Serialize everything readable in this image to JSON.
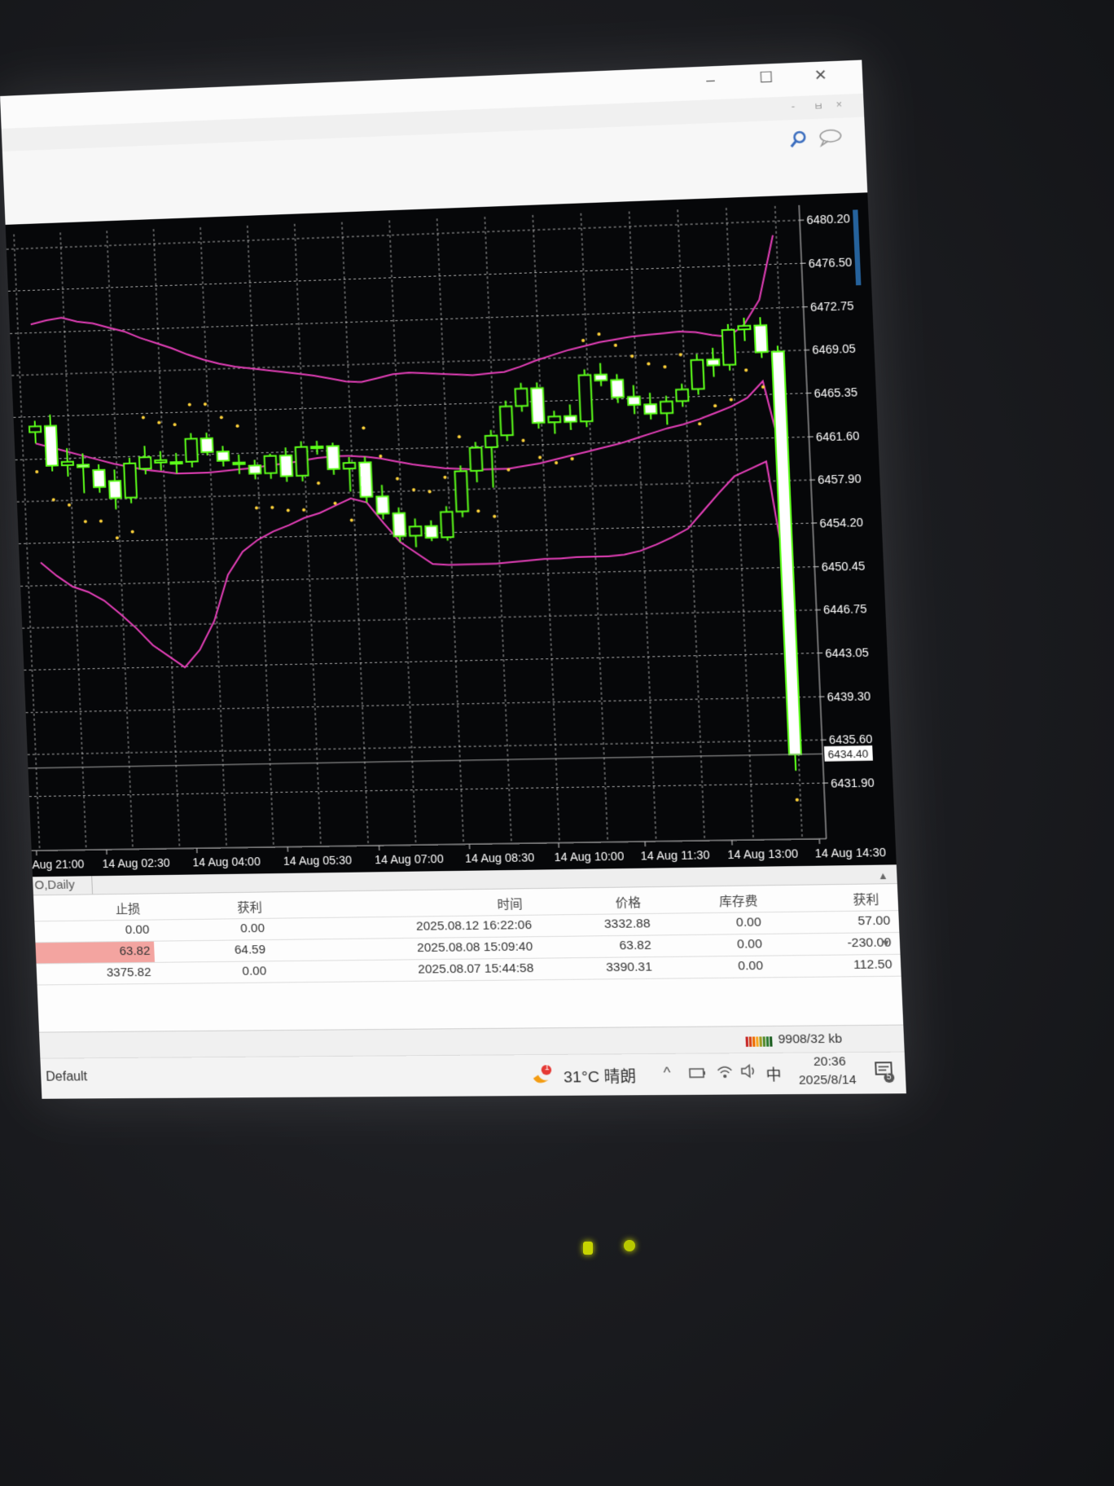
{
  "window": {
    "minimize": "–",
    "maximize": "☐",
    "close": "✕"
  },
  "mdi": {
    "minimize": "-",
    "restore": "ㅂ",
    "close": "×"
  },
  "toolbar_icons": [
    "search-icon",
    "chat-icon"
  ],
  "price_axis": [
    "6480.20",
    "6476.50",
    "6472.75",
    "6469.05",
    "6465.35",
    "6461.60",
    "6457.90",
    "6454.20",
    "6450.45",
    "6446.75",
    "6443.05",
    "6439.30",
    "6435.60",
    "6431.90"
  ],
  "current_price": "6434.40",
  "time_axis": [
    "Aug 21:00",
    "14 Aug 02:30",
    "14 Aug 04:00",
    "14 Aug 05:30",
    "14 Aug 07:00",
    "14 Aug 08:30",
    "14 Aug 10:00",
    "14 Aug 11:30",
    "14 Aug 13:00",
    "14 Aug 14:30"
  ],
  "chart_data": {
    "type": "candlestick",
    "ylim": [
      6430.0,
      6481.5
    ],
    "y_ticks": [
      6480.2,
      6476.5,
      6472.75,
      6469.05,
      6465.35,
      6461.6,
      6457.9,
      6454.2,
      6450.45,
      6446.75,
      6443.05,
      6439.3,
      6435.6,
      6431.9
    ],
    "x_ticks": [
      "Aug 21:00",
      "14 Aug 02:30",
      "14 Aug 04:00",
      "14 Aug 05:30",
      "14 Aug 07:00",
      "14 Aug 08:30",
      "14 Aug 10:00",
      "14 Aug 11:30",
      "14 Aug 13:00",
      "14 Aug 14:30"
    ],
    "candles": [
      [
        6464.0,
        6465.0,
        6463.0,
        6464.5
      ],
      [
        6464.5,
        6465.5,
        6460.5,
        6461.0
      ],
      [
        6461.0,
        6462.5,
        6460.0,
        6461.3
      ],
      [
        6461.0,
        6462.0,
        6458.5,
        6460.8
      ],
      [
        6460.5,
        6461.0,
        6458.5,
        6459.0
      ],
      [
        6459.5,
        6460.5,
        6457.0,
        6458.0
      ],
      [
        6458.0,
        6461.5,
        6457.5,
        6461.0
      ],
      [
        6460.5,
        6462.5,
        6460.0,
        6461.5
      ],
      [
        6461.0,
        6462.0,
        6460.3,
        6461.2
      ],
      [
        6461.0,
        6461.8,
        6460.0,
        6461.0
      ],
      [
        6461.0,
        6463.5,
        6460.5,
        6463.0
      ],
      [
        6463.0,
        6463.5,
        6461.5,
        6461.8
      ],
      [
        6461.8,
        6462.3,
        6460.5,
        6461.0
      ],
      [
        6460.8,
        6461.5,
        6459.8,
        6460.8
      ],
      [
        6460.5,
        6461.0,
        6459.3,
        6459.8
      ],
      [
        6459.8,
        6461.5,
        6459.3,
        6461.3
      ],
      [
        6461.3,
        6462.0,
        6459.0,
        6459.5
      ],
      [
        6459.5,
        6462.5,
        6459.0,
        6462.0
      ],
      [
        6462.0,
        6462.5,
        6461.3,
        6462.0
      ],
      [
        6462.0,
        6462.3,
        6459.5,
        6460.0
      ],
      [
        6460.0,
        6461.0,
        6458.0,
        6460.5
      ],
      [
        6460.5,
        6461.0,
        6457.0,
        6457.5
      ],
      [
        6457.5,
        6458.5,
        6455.5,
        6456.0
      ],
      [
        6456.0,
        6456.5,
        6453.5,
        6454.0
      ],
      [
        6454.0,
        6455.5,
        6453.0,
        6454.8
      ],
      [
        6454.8,
        6455.3,
        6453.5,
        6453.8
      ],
      [
        6453.8,
        6456.5,
        6453.5,
        6456.0
      ],
      [
        6456.0,
        6460.0,
        6455.5,
        6459.5
      ],
      [
        6459.5,
        6462.0,
        6458.5,
        6461.5
      ],
      [
        6461.5,
        6463.0,
        6458.0,
        6462.5
      ],
      [
        6462.5,
        6465.5,
        6462.0,
        6465.0
      ],
      [
        6465.0,
        6467.0,
        6464.5,
        6466.5
      ],
      [
        6466.5,
        6467.0,
        6463.0,
        6463.5
      ],
      [
        6463.5,
        6464.5,
        6462.5,
        6464.0
      ],
      [
        6464.0,
        6465.0,
        6462.8,
        6463.5
      ],
      [
        6463.5,
        6468.0,
        6463.0,
        6467.5
      ],
      [
        6467.5,
        6468.5,
        6466.5,
        6467.0
      ],
      [
        6467.0,
        6467.5,
        6465.0,
        6465.5
      ],
      [
        6465.5,
        6466.5,
        6464.0,
        6464.8
      ],
      [
        6464.8,
        6465.8,
        6463.5,
        6464.0
      ],
      [
        6464.0,
        6465.5,
        6463.0,
        6465.0
      ],
      [
        6465.0,
        6466.5,
        6464.5,
        6466.0
      ],
      [
        6466.0,
        6469.0,
        6465.5,
        6468.5
      ],
      [
        6468.5,
        6469.5,
        6467.0,
        6468.0
      ],
      [
        6468.0,
        6471.5,
        6467.5,
        6471.0
      ],
      [
        6471.0,
        6472.0,
        6470.0,
        6471.3
      ],
      [
        6471.3,
        6472.0,
        6468.5,
        6469.0
      ],
      [
        6469.0,
        6469.5,
        6433.0,
        6434.4
      ]
    ],
    "series": [
      {
        "type": "line",
        "values": [
          6473.5,
          6473.8,
          6474.0,
          6473.6,
          6473.4,
          6473.0,
          6472.6,
          6472.0,
          6471.5,
          6471.0,
          6470.4,
          6469.9,
          6469.5,
          6469.2,
          6469.0,
          6468.8,
          6468.6,
          6468.4,
          6468.2,
          6467.9,
          6467.6,
          6467.5,
          6467.8,
          6468.1,
          6468.2,
          6468.1,
          6468.0,
          6467.9,
          6467.8,
          6467.9,
          6468.0,
          6468.4,
          6468.9,
          6469.3,
          6469.7,
          6470.0,
          6470.3,
          6470.5,
          6470.7,
          6470.8,
          6470.9,
          6471.0,
          6470.9,
          6470.6,
          6470.4,
          6471.4,
          6473.5,
          6479.0
        ]
      },
      {
        "type": "line",
        "values": [
          6463.0,
          6462.6,
          6462.2,
          6461.8,
          6461.4,
          6461.0,
          6460.7,
          6460.4,
          6460.2,
          6460.0,
          6460.0,
          6460.0,
          6460.1,
          6460.2,
          6460.3,
          6460.5,
          6460.6,
          6460.8,
          6461.0,
          6461.1,
          6461.1,
          6461.0,
          6460.8,
          6460.5,
          6460.2,
          6460.0,
          6459.8,
          6459.7,
          6459.6,
          6459.6,
          6459.6,
          6459.8,
          6460.0,
          6460.3,
          6460.6,
          6460.9,
          6461.2,
          6461.5,
          6461.9,
          6462.3,
          6462.7,
          6463.0,
          6463.4,
          6463.9,
          6464.4,
          6465.1,
          6466.5,
          6460.0
        ]
      },
      {
        "type": "line",
        "values": [
          6452.5,
          6451.3,
          6450.3,
          6449.8,
          6449.0,
          6447.8,
          6446.5,
          6445.0,
          6444.0,
          6443.0,
          6444.5,
          6447.0,
          6451.0,
          6453.0,
          6454.0,
          6454.7,
          6455.2,
          6455.8,
          6456.2,
          6456.8,
          6457.4,
          6457.0,
          6455.2,
          6453.5,
          6452.5,
          6451.5,
          6451.4,
          6451.4,
          6451.4,
          6451.4,
          6451.5,
          6451.6,
          6451.7,
          6451.7,
          6451.8,
          6451.8,
          6451.8,
          6451.9,
          6452.2,
          6452.7,
          6453.3,
          6454.0,
          6455.5,
          6457.0,
          6458.4,
          6459.0,
          6459.6,
          6449.0
        ]
      }
    ]
  },
  "terminal": {
    "tab_label": "O,Daily",
    "headers": {
      "sl": "止损",
      "tp": "获利",
      "time": "时间",
      "price": "价格",
      "swap": "库存费",
      "profit": "获利"
    },
    "rows": [
      {
        "sl": "0.00",
        "tp": "0.00",
        "time": "2025.08.12 16:22:06",
        "price": "3332.88",
        "swap": "0.00",
        "profit": "57.00"
      },
      {
        "sl": "63.82",
        "tp": "64.59",
        "time": "2025.08.08 15:09:40",
        "price": "63.82",
        "swap": "0.00",
        "profit": "-230.00"
      },
      {
        "sl": "3375.82",
        "tp": "0.00",
        "time": "2025.08.07 15:44:58",
        "price": "3390.31",
        "swap": "0.00",
        "profit": "112.50"
      }
    ]
  },
  "statusbar": {
    "profile": "Default",
    "traffic": "9908/32 kb"
  },
  "taskbar": {
    "weather": "31°C 晴朗",
    "ime": "中",
    "time": "20:36",
    "date": "2025/8/14",
    "notification_count": "5",
    "weather_badge": "1"
  }
}
